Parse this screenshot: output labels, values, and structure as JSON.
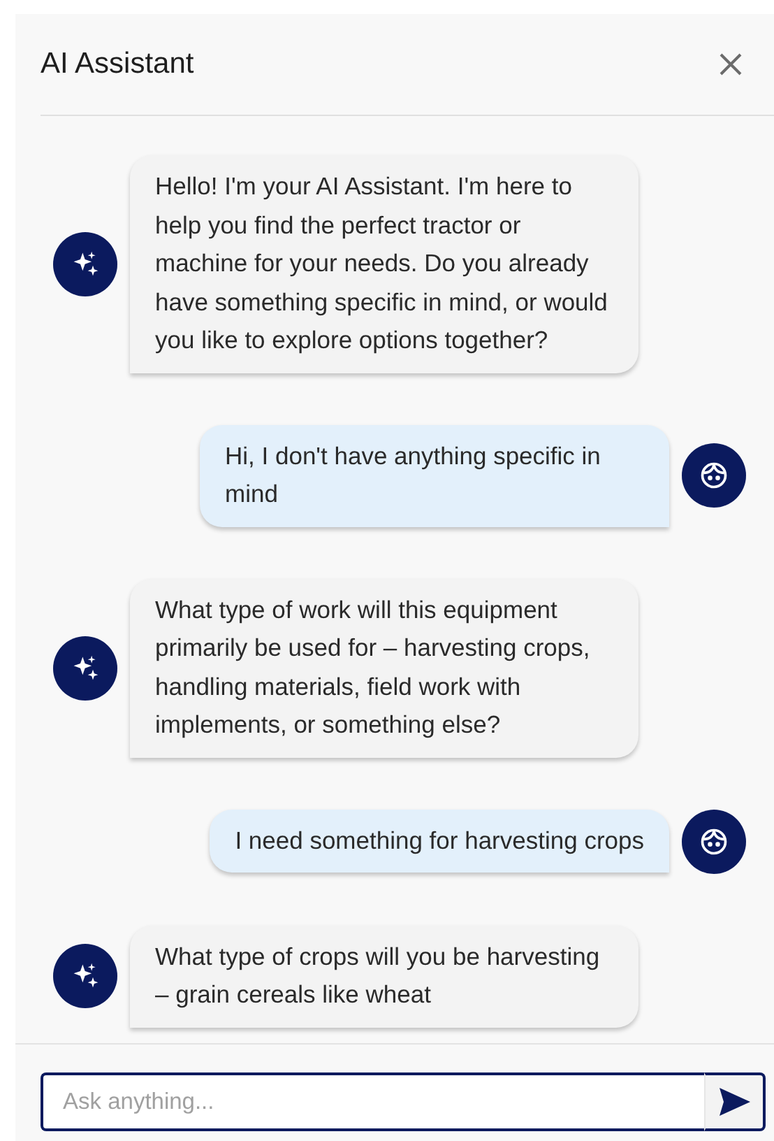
{
  "header": {
    "title": "AI Assistant"
  },
  "messages": [
    {
      "kind": "assistant",
      "text": "Hello! I'm your AI Assistant. I'm here to help you find the perfect tractor or machine for your needs. Do you already have something specific in mind, or would you like to explore options together?"
    },
    {
      "kind": "user",
      "text": "Hi, I don't have anything specific in mind"
    },
    {
      "kind": "assistant",
      "text": "What type of work will this equipment primarily be used for – harvesting crops, handling materials, field work with implements, or something else?"
    },
    {
      "kind": "user",
      "text": "I need something for harvesting crops"
    },
    {
      "kind": "assistant",
      "text": "What type of crops will you be harvesting – grain cereals like wheat"
    }
  ],
  "composer": {
    "placeholder": "Ask anything..."
  }
}
